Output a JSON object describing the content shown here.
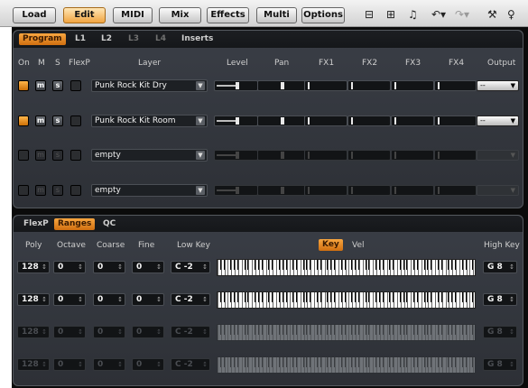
{
  "toolbar": {
    "buttons": [
      {
        "label": "Load",
        "active": false
      },
      {
        "label": "Edit",
        "active": true
      },
      {
        "label": "MIDI",
        "active": false
      },
      {
        "label": "Mix",
        "active": false
      },
      {
        "label": "Effects",
        "active": false
      },
      {
        "label": "Multi",
        "active": false
      },
      {
        "label": "Options",
        "active": false
      }
    ],
    "icons": [
      "add-layer-icon",
      "copy-layer-icon",
      "note-icon",
      "undo-icon",
      "redo-icon",
      "tools-icon",
      "pin-icon"
    ]
  },
  "top_tabs": [
    {
      "label": "Program",
      "active": true
    },
    {
      "label": "L1",
      "active": false
    },
    {
      "label": "L2",
      "active": false
    },
    {
      "label": "L3",
      "active": false,
      "dim": true
    },
    {
      "label": "L4",
      "active": false,
      "dim": true
    },
    {
      "label": "Inserts",
      "active": false
    }
  ],
  "columns": {
    "on": "On",
    "m": "M",
    "s": "S",
    "flexp": "FlexP",
    "layer": "Layer",
    "level": "Level",
    "pan": "Pan",
    "fx1": "FX1",
    "fx2": "FX2",
    "fx3": "FX3",
    "fx4": "FX4",
    "output": "Output"
  },
  "tracks": [
    {
      "name": "Punk Rock Kit Dry",
      "on": true,
      "m_label": "m",
      "s_label": "s",
      "output": "--",
      "level": 0.55,
      "pan": 0.5,
      "enabled": true
    },
    {
      "name": "Punk Rock Kit Room",
      "on": true,
      "m_label": "m",
      "s_label": "s",
      "output": "--",
      "level": 0.55,
      "pan": 0.5,
      "enabled": true
    },
    {
      "name": "empty",
      "on": false,
      "m_label": "m",
      "s_label": "s",
      "output": "",
      "level": 0.55,
      "pan": 0.5,
      "enabled": false
    },
    {
      "name": "empty",
      "on": false,
      "m_label": "m",
      "s_label": "s",
      "output": "",
      "level": 0.55,
      "pan": 0.5,
      "enabled": false
    }
  ],
  "bottom_tabs": [
    {
      "label": "FlexP",
      "active": false
    },
    {
      "label": "Ranges",
      "active": true
    },
    {
      "label": "QC",
      "active": false
    }
  ],
  "range_columns": {
    "poly": "Poly",
    "octave": "Octave",
    "coarse": "Coarse",
    "fine": "Fine",
    "low_key": "Low Key",
    "key": "Key",
    "vel": "Vel",
    "high_key": "High Key"
  },
  "ranges": [
    {
      "poly": "128",
      "octave": "0",
      "coarse": "0",
      "fine": "0",
      "low_key": "C -2",
      "high_key": "G 8",
      "enabled": true
    },
    {
      "poly": "128",
      "octave": "0",
      "coarse": "0",
      "fine": "0",
      "low_key": "C -2",
      "high_key": "G 8",
      "enabled": true
    },
    {
      "poly": "128",
      "octave": "0",
      "coarse": "0",
      "fine": "0",
      "low_key": "C -2",
      "high_key": "G 8",
      "enabled": false
    },
    {
      "poly": "128",
      "octave": "0",
      "coarse": "0",
      "fine": "0",
      "low_key": "C -2",
      "high_key": "G 8",
      "enabled": false
    }
  ],
  "spin_glyph": "↕",
  "dropdown_glyph": "▼"
}
